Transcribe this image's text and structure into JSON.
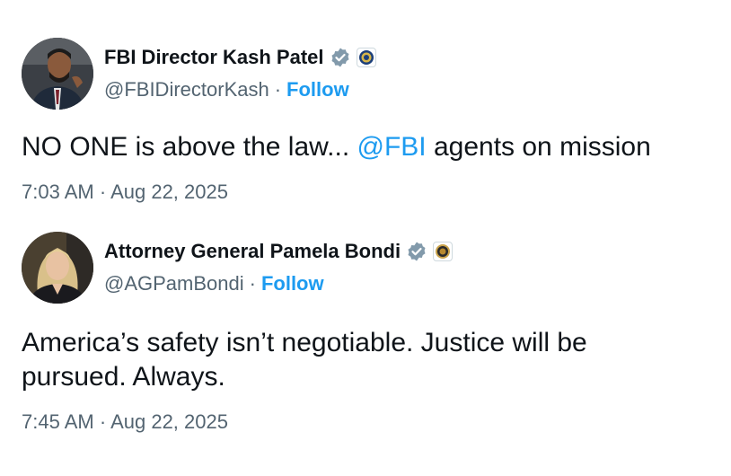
{
  "tweets": [
    {
      "display_name": "FBI Director Kash Patel",
      "handle": "@FBIDirectorKash",
      "separator": "·",
      "follow_label": "Follow",
      "text_before": "NO ONE is above the law... ",
      "mention": "@FBI",
      "text_after": " agents on mission",
      "time": "7:03 AM",
      "date": "Aug 22, 2025",
      "verified_icon": "verified-badge-gray",
      "affiliation_icon": "fbi-seal"
    },
    {
      "display_name": "Attorney General Pamela Bondi",
      "handle": "@AGPamBondi",
      "separator": "·",
      "follow_label": "Follow",
      "text_line1": "America’s safety isn’t negotiable. Justice will be",
      "text_line2": "pursued. Always.",
      "time": "7:45 AM",
      "date": "Aug 22, 2025",
      "verified_icon": "verified-badge-gray",
      "affiliation_icon": "doj-seal"
    }
  ],
  "colors": {
    "link": "#1d9bf0",
    "secondary_text": "#536471",
    "primary_text": "#0f1419",
    "verified_badge": "#829aab"
  }
}
